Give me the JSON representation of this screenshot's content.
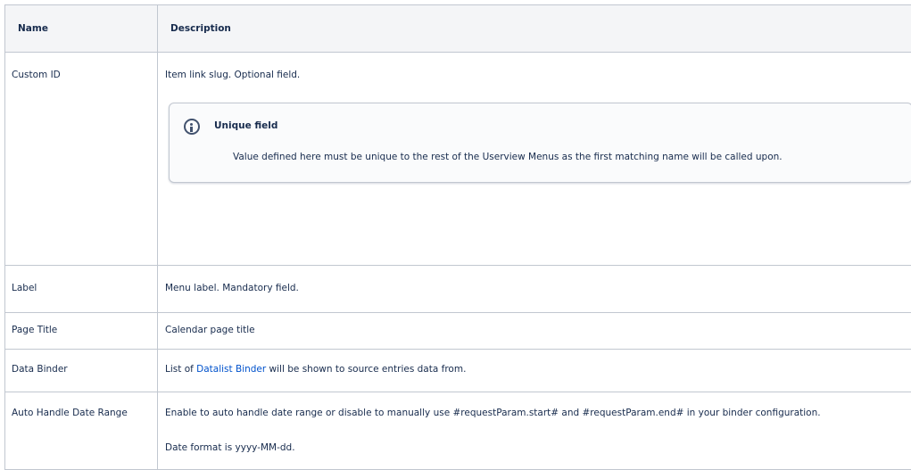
{
  "table": {
    "headers": {
      "name": "Name",
      "description": "Description"
    },
    "rows": {
      "custom_id": {
        "name": "Custom ID",
        "description": "Item link slug. Optional field.",
        "info_panel": {
          "icon": "info-icon",
          "title": "Unique field",
          "body": "Value defined here must be unique to the rest of the Userview Menus as the first matching name will be called upon."
        }
      },
      "label": {
        "name": "Label",
        "description": "Menu label. Mandatory field."
      },
      "page_title": {
        "name": "Page Title",
        "description": "Calendar page title"
      },
      "data_binder": {
        "name": "Data Binder",
        "description_before": "List of ",
        "link_text": "Datalist Binder",
        "description_after": " will be shown to source entries data from."
      },
      "auto_handle": {
        "name": "Auto Handle Date Range",
        "description": "Enable to auto handle date range or disable to manually use #requestParam.start# and #requestParam.end# in your binder configuration.",
        "note": "Date format is yyyy-MM-dd."
      }
    }
  },
  "colors": {
    "link": "#0052cc",
    "header_bg": "#f4f5f7",
    "border": "#c1c7d0",
    "text": "#172b4d"
  }
}
